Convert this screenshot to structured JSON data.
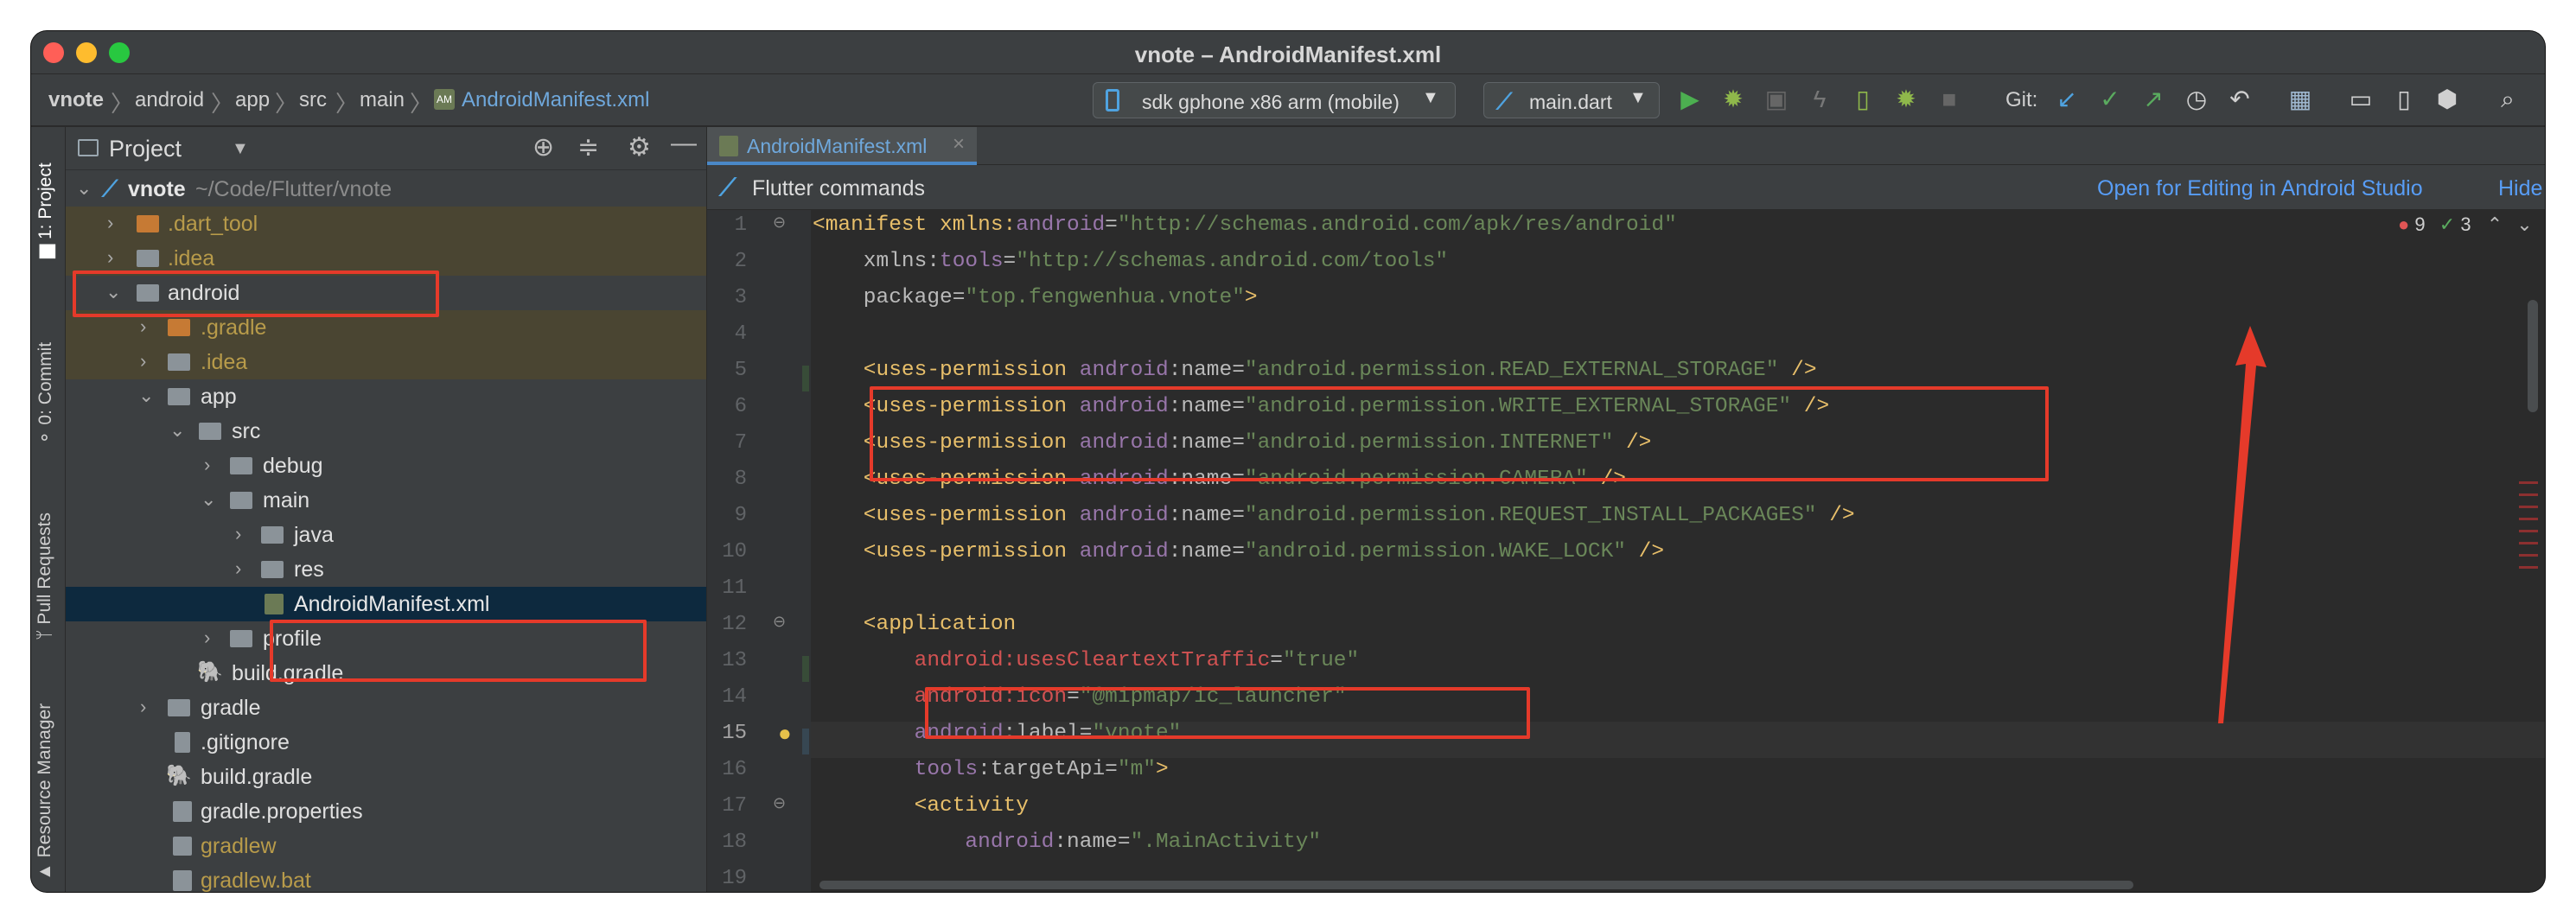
{
  "window": {
    "title": "vnote – AndroidManifest.xml"
  },
  "breadcrumb": [
    "vnote",
    "android",
    "app",
    "src",
    "main",
    "AndroidManifest.xml"
  ],
  "toolbar": {
    "device": "sdk gphone x86 arm (mobile)",
    "run_config": "main.dart",
    "git_label": "Git:"
  },
  "left_strip": {
    "project": "1: Project",
    "commit": "0: Commit",
    "pull_requests": "Pull Requests",
    "resource_manager": "Resource Manager"
  },
  "project": {
    "title": "Project",
    "tree": [
      {
        "label": "vnote",
        "path": "~/Code/Flutter/vnote"
      },
      {
        "label": ".dart_tool"
      },
      {
        "label": ".idea"
      },
      {
        "label": "android"
      },
      {
        "label": ".gradle"
      },
      {
        "label": ".idea"
      },
      {
        "label": "app"
      },
      {
        "label": "src"
      },
      {
        "label": "debug"
      },
      {
        "label": "main"
      },
      {
        "label": "java"
      },
      {
        "label": "res"
      },
      {
        "label": "AndroidManifest.xml"
      },
      {
        "label": "profile"
      },
      {
        "label": "build.gradle"
      },
      {
        "label": "gradle"
      },
      {
        "label": ".gitignore"
      },
      {
        "label": "build.gradle"
      },
      {
        "label": "gradle.properties"
      },
      {
        "label": "gradlew"
      },
      {
        "label": "gradlew.bat"
      }
    ]
  },
  "editor": {
    "tab": "AndroidManifest.xml",
    "banner_title": "Flutter commands",
    "banner_open": "Open for Editing in Android Studio",
    "banner_hide": "Hide",
    "errors": "9",
    "warnings": "3",
    "line_numbers": [
      "1",
      "2",
      "3",
      "4",
      "5",
      "6",
      "7",
      "8",
      "9",
      "10",
      "11",
      "12",
      "13",
      "14",
      "15",
      "16",
      "17",
      "18",
      "19"
    ],
    "lines": [
      [
        "<manifest ",
        "xmlns:",
        "android",
        "=",
        "\"http://schemas.android.com/apk/res/android\""
      ],
      [
        "    xmlns:",
        "tools",
        "=",
        "\"http://schemas.android.com/tools\""
      ],
      [
        "    package",
        "=",
        "\"top.fengwenhua.vnote\"",
        ">"
      ],
      [
        ""
      ],
      [
        "    <uses-permission ",
        "android",
        ":name=",
        "\"android.permission.READ_EXTERNAL_STORAGE\"",
        " />"
      ],
      [
        "    <uses-permission ",
        "android",
        ":name=",
        "\"android.permission.WRITE_EXTERNAL_STORAGE\"",
        " />"
      ],
      [
        "    <uses-permission ",
        "android",
        ":name=",
        "\"android.permission.INTERNET\"",
        " />"
      ],
      [
        "    <uses-permission ",
        "android",
        ":name=",
        "\"android.permission.CAMERA\"",
        " />"
      ],
      [
        "    <uses-permission ",
        "android",
        ":name=",
        "\"android.permission.REQUEST_INSTALL_PACKAGES\"",
        " />"
      ],
      [
        "    <uses-permission ",
        "android",
        ":name=",
        "\"android.permission.WAKE_LOCK\"",
        " />"
      ],
      [
        ""
      ],
      [
        "    <application"
      ],
      [
        "        android:usesCleartextTraffic",
        "=",
        "\"true\""
      ],
      [
        "        android:icon",
        "=",
        "\"@mipmap/ic_launcher\""
      ],
      [
        "        android",
        ":label=",
        "\"vnote\""
      ],
      [
        "        tools",
        ":targetApi=",
        "\"m\"",
        ">"
      ],
      [
        "        <activity"
      ],
      [
        "            android",
        ":name=",
        "\".MainActivity\""
      ],
      [
        ""
      ]
    ]
  },
  "colors": {
    "annotation": "#e53a2a",
    "link": "#589df6",
    "selection": "#0d293e"
  }
}
